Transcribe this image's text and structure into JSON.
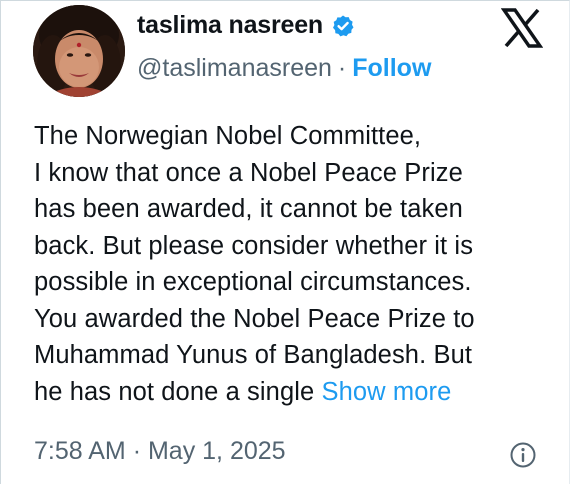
{
  "author": {
    "name": "taslima nasreen",
    "handle": "@taslimanasreen",
    "separator": "·",
    "follow_label": "Follow",
    "verified_icon": "verified-badge-icon",
    "accent_color": "#1d9bf0"
  },
  "brand": {
    "icon": "x-logo-icon"
  },
  "tweet": {
    "lines": [
      "The Norwegian Nobel Committee,",
      "I know that once a Nobel Peace Prize",
      "has been awarded, it cannot be taken",
      "back. But please consider whether it is",
      "possible in exceptional circumstances.",
      "You awarded the Nobel Peace Prize to",
      "Muhammad Yunus of Bangladesh. But",
      "he has not done a single"
    ],
    "show_more_label": "Show more"
  },
  "meta": {
    "time": "7:58 AM",
    "separator": "·",
    "date": "May 1, 2025",
    "info_icon": "info-icon"
  }
}
